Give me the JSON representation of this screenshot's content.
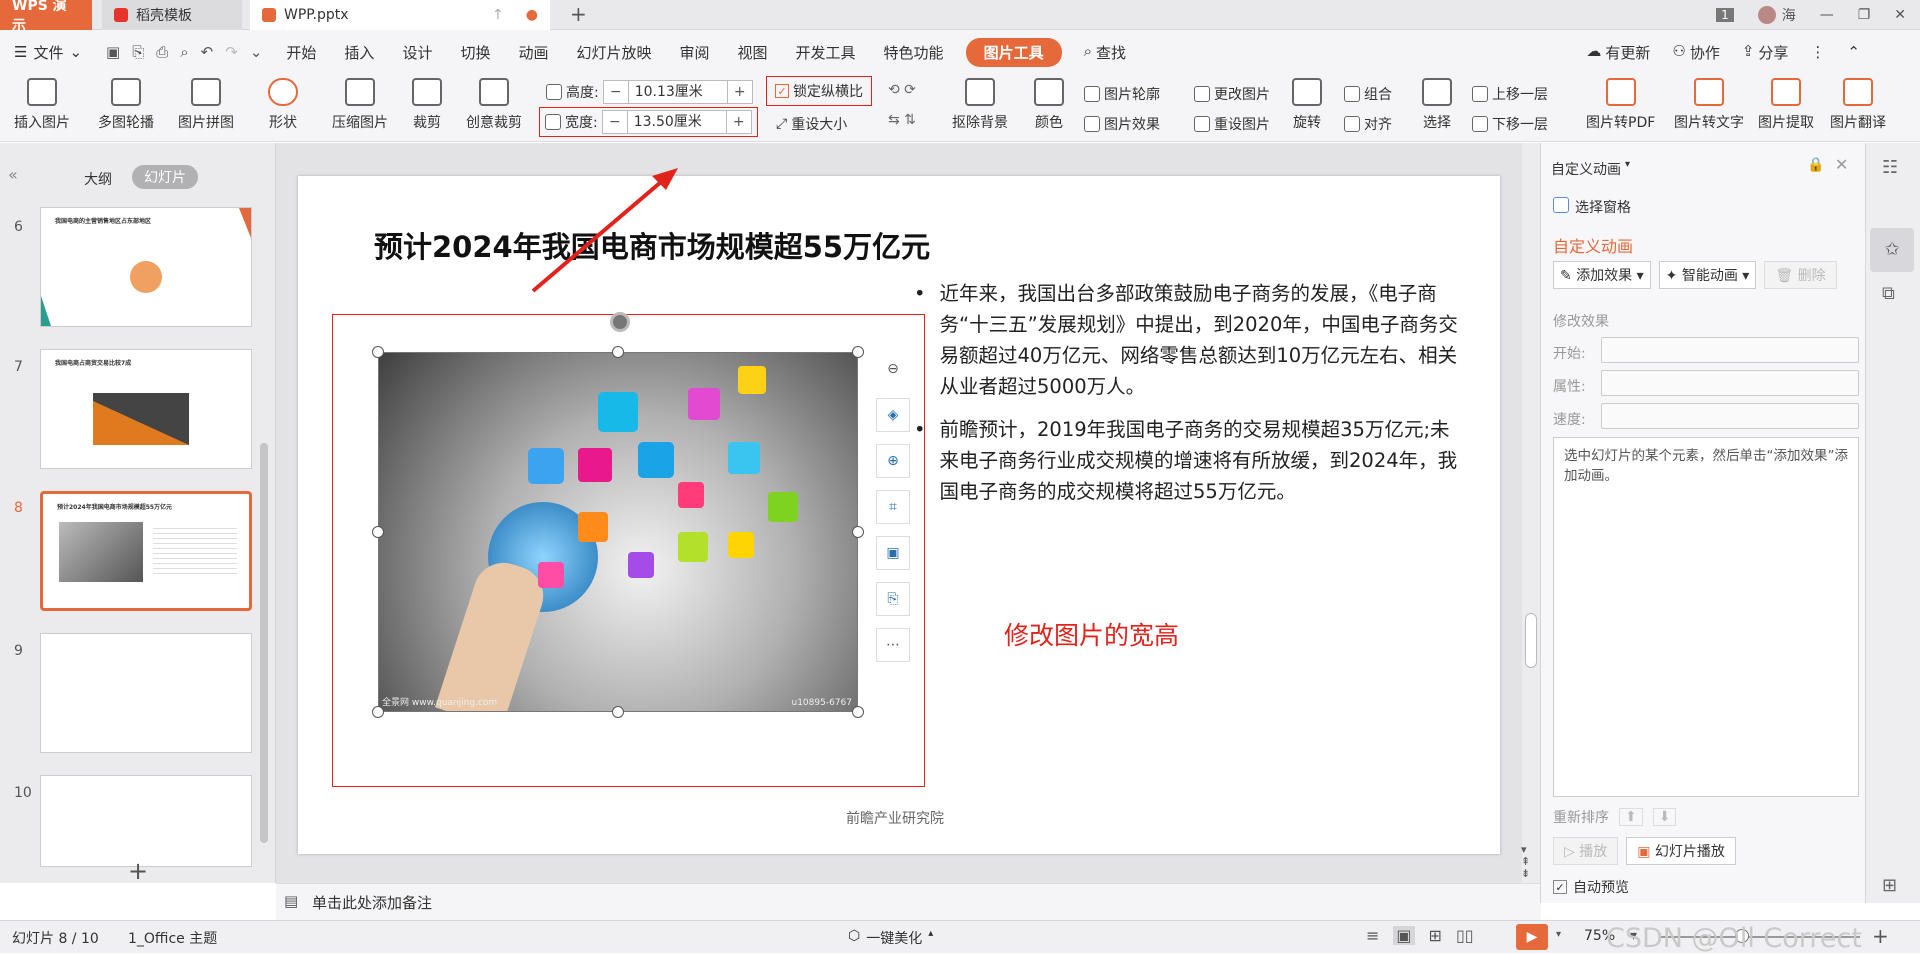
{
  "titlebar": {
    "app_tab": "WPS 演示",
    "template_tab": "稻壳模板",
    "doc_tab": "WPP.pptx",
    "new_tab": "+",
    "page_badge": "1",
    "user": "海"
  },
  "menu": {
    "file": "文件",
    "items": [
      "开始",
      "插入",
      "设计",
      "切换",
      "动画",
      "幻灯片放映",
      "审阅",
      "视图",
      "开发工具",
      "特色功能"
    ],
    "active": "图片工具",
    "search": "查找",
    "update": "有更新",
    "collab": "协作",
    "share": "分享"
  },
  "ribbon": {
    "insert_pic": "插入图片",
    "carousel": "多图轮播",
    "collage": "图片拼图",
    "shape": "形状",
    "compress": "压缩图片",
    "crop": "裁剪",
    "creative_crop": "创意裁剪",
    "height_label": "高度:",
    "height_value": "10.13厘米",
    "width_label": "宽度:",
    "width_value": "13.50厘米",
    "lock_ratio": "锁定纵横比",
    "reset_size": "重设大小",
    "remove_bg": "抠除背景",
    "color": "颜色",
    "outline": "图片轮廓",
    "effect": "图片效果",
    "change_pic": "更改图片",
    "reset_pic": "重设图片",
    "rotate": "旋转",
    "group": "组合",
    "align": "对齐",
    "select": "选择",
    "bring_forward": "上移一层",
    "send_backward": "下移一层",
    "to_pdf": "图片转PDF",
    "to_text": "图片转文字",
    "extract": "图片提取",
    "translate": "图片翻译"
  },
  "leftpanel": {
    "outline_tab": "大纲",
    "slides_tab": "幻灯片",
    "slide_numbers": [
      "6",
      "7",
      "8",
      "9",
      "10"
    ],
    "thumb6_title": "我国电商的主营销售地区占东部地区",
    "thumb7_title": "我国电商占商贸交易比较7成",
    "thumb8_title": "预计2024年我国电商市场规模超55万亿元",
    "add": "+"
  },
  "slide": {
    "title": "预计2024年我国电商市场规模超55万亿元",
    "bullet1": "近年来，我国出台多部政策鼓励电子商务的发展，《电子商务“十三五”发展规划》中提出，到2020年，中国电子商务交易额超过40万亿元、网络零售总额达到10万亿元左右、相关从业者超过5000万人。",
    "bullet2": "前瞻预计，2019年我国电子商务的交易规模超35万亿元;未来电子商务行业成交规模的增速将有所放缓，到2024年，我国电子商务的成交规模将超过55万亿元。",
    "annotation": "修改图片的宽高",
    "source": "前瞻产业研究院",
    "watermark_left": "全景网 www.quanjing.com",
    "watermark_right": "u10895-6767"
  },
  "rightpanel": {
    "header": "自定义动画",
    "select_pane": "选择窗格",
    "section": "自定义动画",
    "add_effect": "添加效果",
    "smart_anim": "智能动画",
    "delete": "删除",
    "modify": "修改效果",
    "start": "开始:",
    "property": "属性:",
    "speed": "速度:",
    "hint": "选中幻灯片的某个元素，然后单击“添加效果”添加动画。",
    "reorder": "重新排序",
    "play": "播放",
    "slideshow": "幻灯片播放",
    "autopreview": "自动预览"
  },
  "notes": {
    "placeholder": "单击此处添加备注"
  },
  "status": {
    "slide_info": "幻灯片 8 / 10",
    "theme": "1_Office 主题",
    "beautify": "一键美化",
    "zoom": "75%",
    "watermark": "CSDN @Oll Correct"
  },
  "colors": {
    "accent": "#e5693a",
    "red": "#e1231b",
    "text": "#333333"
  }
}
